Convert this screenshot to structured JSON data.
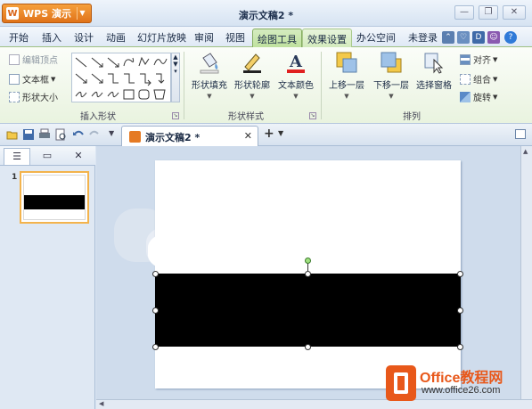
{
  "app": {
    "menu_button": "WPS 演示",
    "doc_title": "演示文稿2 *"
  },
  "tabs": [
    {
      "label": "开始"
    },
    {
      "label": "插入"
    },
    {
      "label": "设计"
    },
    {
      "label": "动画"
    },
    {
      "label": "幻灯片放映"
    },
    {
      "label": "审阅"
    },
    {
      "label": "视图"
    },
    {
      "label": "绘图工具"
    },
    {
      "label": "效果设置"
    },
    {
      "label": "办公空间"
    },
    {
      "label": "未登录"
    }
  ],
  "ribbon": {
    "insert_shape": {
      "edit_points": "编辑顶点",
      "text_box": "文本框",
      "shape_size": "形状大小",
      "group_label": "插入形状"
    },
    "shape_style": {
      "fill": "形状填充",
      "outline": "形状轮廓",
      "text_color": "文本颜色",
      "group_label": "形状样式"
    },
    "arrange": {
      "bring_forward": "上移一层",
      "send_backward": "下移一层",
      "selection_pane": "选择窗格",
      "align": "对齐",
      "group": "组合",
      "rotate": "旋转",
      "group_label": "排列"
    }
  },
  "document_tab": {
    "label": "演示文稿2 *"
  },
  "slide_panel": {
    "slide_number": "1"
  },
  "watermark": {
    "title": "Office教程网",
    "url": "www.office26.com"
  },
  "colors": {
    "accent_orange": "#e8581a",
    "ribbon_green": "#bfe19e",
    "selection_border": "#f3b34c"
  }
}
